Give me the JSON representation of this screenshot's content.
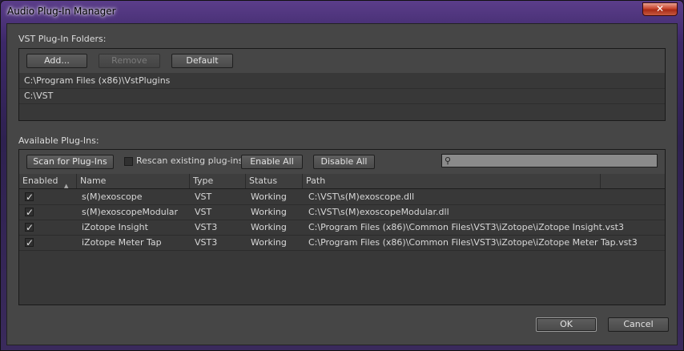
{
  "window": {
    "title": "Audio Plug-In Manager",
    "close_label": "✕"
  },
  "folders": {
    "label": "VST Plug-In Folders:",
    "add_label": "Add...",
    "remove_label": "Remove",
    "default_label": "Default",
    "paths": [
      "C:\\Program Files (x86)\\VstPlugins",
      "C:\\VST"
    ]
  },
  "plugins": {
    "label": "Available Plug-Ins:",
    "scan_label": "Scan for Plug-Ins",
    "rescan_label": "Rescan existing plug-ins",
    "rescan_checked": false,
    "enable_all_label": "Enable All",
    "disable_all_label": "Disable All",
    "search_value": "",
    "columns": [
      "Enabled",
      "Name",
      "Type",
      "Status",
      "Path"
    ],
    "rows": [
      {
        "enabled": true,
        "name": "s(M)exoscope",
        "type": "VST",
        "status": "Working",
        "path": "C:\\VST\\s(M)exoscope.dll"
      },
      {
        "enabled": true,
        "name": "s(M)exoscopeModular",
        "type": "VST",
        "status": "Working",
        "path": "C:\\VST\\s(M)exoscopeModular.dll"
      },
      {
        "enabled": true,
        "name": "iZotope Insight",
        "type": "VST3",
        "status": "Working",
        "path": "C:\\Program Files (x86)\\Common Files\\VST3\\iZotope\\iZotope Insight.vst3"
      },
      {
        "enabled": true,
        "name": "iZotope Meter Tap",
        "type": "VST3",
        "status": "Working",
        "path": "C:\\Program Files (x86)\\Common Files\\VST3\\iZotope\\iZotope Meter Tap.vst3"
      }
    ]
  },
  "footer": {
    "ok_label": "OK",
    "cancel_label": "Cancel"
  },
  "colors": {
    "panel": "#464646",
    "list": "#383838",
    "title_glow": "#ffffff",
    "close_red": "#c8452e"
  }
}
